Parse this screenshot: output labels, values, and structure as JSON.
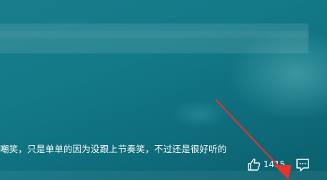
{
  "comment": {
    "text": "嘲笑，只是单单的因为没跟上节奏笑，不过还是很好听的"
  },
  "actions": {
    "like_count": "1415",
    "like_icon": "thumbs-up-icon",
    "comment_icon": "speech-bubble-icon"
  },
  "colors": {
    "background": "#137a88",
    "arrow": "#e8332b",
    "text": "#ffffff"
  }
}
